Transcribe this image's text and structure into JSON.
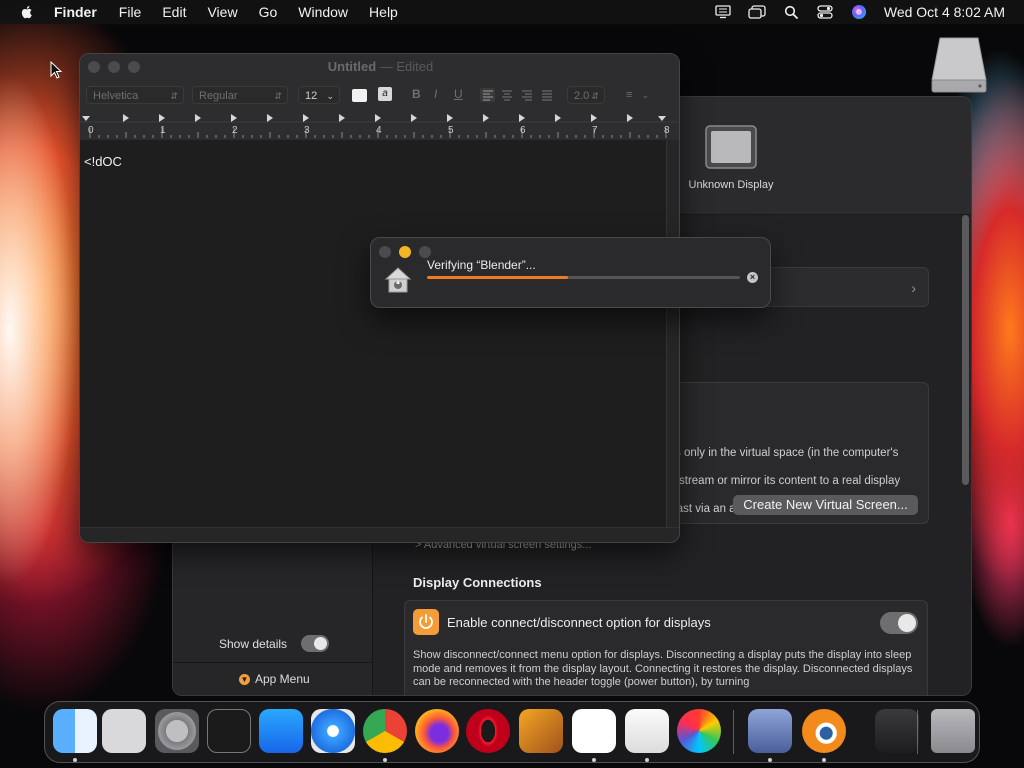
{
  "menubar": {
    "app_name": "Finder",
    "items": [
      "File",
      "Edit",
      "View",
      "Go",
      "Window",
      "Help"
    ],
    "clock": "Wed Oct 4  8:02 AM",
    "status_icons": [
      "screen-mirroring-icon",
      "stage-manager-icon",
      "spotlight-search-icon",
      "control-center-icon",
      "siri-icon"
    ]
  },
  "settings_window": {
    "display_name": "Unknown Display",
    "virtual_screen_text_line1": "s only in the virtual space (in the computer's",
    "virtual_screen_text_line2": "stream or mirror its content to a real display",
    "virtual_screen_text_line3": "cast via an appropriate app.",
    "create_button": "Create New Virtual Screen...",
    "advanced_link": "> Advanced virtual screen settings...",
    "section_title": "Display Connections",
    "connect_option_title": "Enable connect/disconnect option for displays",
    "connect_option_desc": "Show disconnect/connect menu option for displays. Disconnecting a display puts the display into sleep mode and removes it from the display layout. Connecting it restores the display. Disconnected displays can be reconnected with the header toggle (power button), by turning",
    "show_details": "Show details",
    "app_menu": "App Menu"
  },
  "textedit": {
    "title": "Untitled",
    "title_sep": " — ",
    "title_state": "Edited",
    "font_family": "Helvetica",
    "font_style": "Regular",
    "font_size": "12",
    "bold": "B",
    "italic": "I",
    "underline": "U",
    "line_spacing": "2.0",
    "ruler_numbers": [
      "0",
      "1",
      "2",
      "3",
      "4",
      "5",
      "6",
      "7",
      "8"
    ],
    "document_text": "<!dOC"
  },
  "verify_dialog": {
    "label": "Verifying “Blender”...",
    "progress": 0.45,
    "colors": {
      "progress": "#f07a22",
      "minimize": "#f5b625"
    }
  },
  "dock": {
    "apps": [
      {
        "name": "finder-icon",
        "running": true
      },
      {
        "name": "launchpad-icon",
        "running": false
      },
      {
        "name": "system-settings-icon",
        "running": false
      },
      {
        "name": "terminal-icon",
        "running": false
      },
      {
        "name": "app-store-icon",
        "running": false
      },
      {
        "name": "safari-icon",
        "running": false
      },
      {
        "name": "chrome-icon",
        "running": true
      },
      {
        "name": "firefox-icon",
        "running": false
      },
      {
        "name": "opera-icon",
        "running": false
      },
      {
        "name": "garageband-icon",
        "running": false
      },
      {
        "name": "vscode-icon",
        "running": true
      },
      {
        "name": "textedit-icon",
        "running": true
      },
      {
        "name": "color-picker-icon",
        "running": false
      },
      {
        "name": "display-app-icon",
        "running": true
      },
      {
        "name": "blender-icon",
        "running": true
      },
      {
        "name": "downloads-stack-icon",
        "running": false
      },
      {
        "name": "trash-icon",
        "running": false
      }
    ]
  }
}
